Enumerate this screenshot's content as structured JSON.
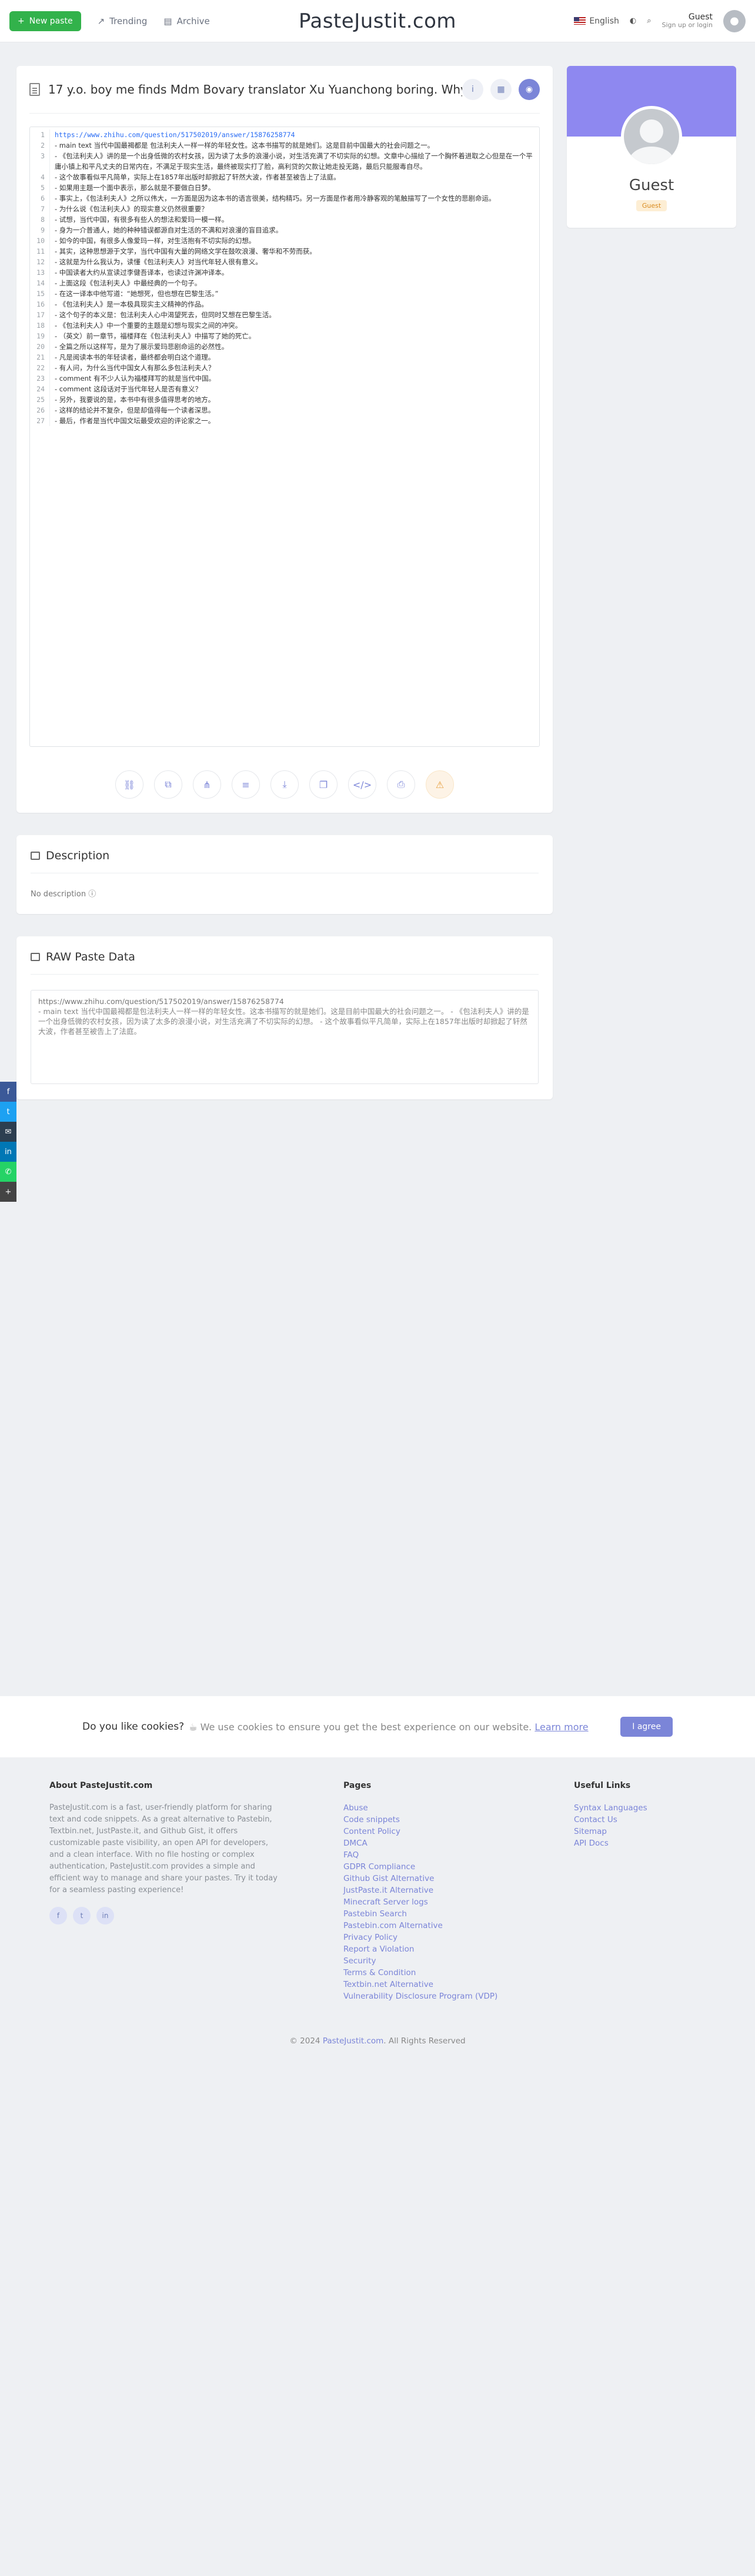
{
  "nav": {
    "new_paste": "New paste",
    "trending": "Trending",
    "archive": "Archive",
    "brand": "PasteJustit.com",
    "language": "English",
    "user_name": "Guest",
    "user_sub": "Sign up or login"
  },
  "paste": {
    "title": "17 y.o. boy me finds Mdm Bovary translator Xu Yuanchong boring. Why",
    "lines": [
      {
        "n": "1",
        "t": "https://www.zhihu.com/question/517502019/answer/15876258774",
        "url": true
      },
      {
        "n": "2",
        "t": "- main text 当代中国最褐都是 包法利夫人一样一样的年轻女性。这本书描写的就是她们。这是目前中国最大的社会问题之一。"
      },
      {
        "n": "3",
        "t": "- 《包法利夫人》讲的是一个出身低微的农村女孩，因为读了太多的浪漫小说，对生活充满了不切实际的幻想。文章中心描绘了一个胸怀着进取之心但是在一个平庸小镇上和平凡丈夫的日常内在，不满足于现实生活，最终被现实打了脸，高利贷的欠款让她走投无路，最后只能服毒自尽。"
      },
      {
        "n": "4",
        "t": "- 这个故事看似平凡简单，实际上在1857年出版时却掀起了轩然大波，作者甚至被告上了法庭。"
      },
      {
        "n": "5",
        "t": "- 如果用主题一个面中表示，那么就是不要做白日梦。"
      },
      {
        "n": "6",
        "t": "- 事实上，《包法利夫人》之所以伟大，一方面是因为这本书的语言很美，结构精巧。另一方面是作者用冷静客观的笔触描写了一个女性的悲剧命运。"
      },
      {
        "n": "7",
        "t": "- 为什么说《包法利夫人》的现实意义仍然很重要？"
      },
      {
        "n": "8",
        "t": "- 试想，当代中国，有很多有些人的想法和爱玛一模一样。"
      },
      {
        "n": "9",
        "t": "- 身为一介普通人，她的种种错误都源自对生活的不满和对浪漫的盲目追求。"
      },
      {
        "n": "10",
        "t": "- 如今的中国，有很多人像爱玛一样，对生活抱有不切实际的幻想。"
      },
      {
        "n": "11",
        "t": "- 其实，这种思想源于文学，当代中国有大量的网络文学在鼓吹浪漫、奢华和不劳而获。"
      },
      {
        "n": "12",
        "t": "- 这就是为什么我认为，读懂《包法利夫人》对当代年轻人很有意义。"
      },
      {
        "n": "13",
        "t": "- 中国读者大约从宣读过李健吾译本，也读过许渊冲译本。"
      },
      {
        "n": "14",
        "t": "- 上面这段《包法利夫人》中最经典的一个句子。"
      },
      {
        "n": "15",
        "t": "- 在这一译本中他写道：“她想死，但也想在巴黎生活。”"
      },
      {
        "n": "16",
        "t": "- 《包法利夫人》是一本极具现实主义精神的作品。"
      },
      {
        "n": "17",
        "t": "- 这个句子的本义是：包法利夫人心中渴望死去，但同时又想在巴黎生活。"
      },
      {
        "n": "18",
        "t": "- 《包法利夫人》中一个重要的主题是幻想与现实之间的冲突。"
      },
      {
        "n": "19",
        "t": "- （英文）前一章节，福楼拜在《包法利夫人》中描写了她的死亡。"
      },
      {
        "n": "20",
        "t": "- 全篇之所以这样写，是为了展示爱玛悲剧命运的必然性。"
      },
      {
        "n": "21",
        "t": "- 凡是阅读本书的年轻读者，最终都会明白这个道理。"
      },
      {
        "n": "22",
        "t": "- 有人问，为什么当代中国女人有那么多包法利夫人？"
      },
      {
        "n": "23",
        "t": "- comment 有不少人认为福楼拜写的就是当代中国。"
      },
      {
        "n": "24",
        "t": "- comment 这段话对于当代年轻人是否有意义？"
      },
      {
        "n": "25",
        "t": "- 另外，我要说的是，本书中有很多值得思考的地方。"
      },
      {
        "n": "26",
        "t": "- 这样的结论并不复杂，但是却值得每一个读者深思。"
      },
      {
        "n": "27",
        "t": "- 最后，作者是当代中国文坛最受欢迎的评论家之一。"
      }
    ]
  },
  "description": {
    "title": "Description",
    "empty": "No description"
  },
  "raw": {
    "title": "RAW Paste Data",
    "url": "https://www.zhihu.com/question/517502019/answer/15876258774",
    "text": "- main text 当代中国最褐都是包法利夫人一样一样的年轻女性。这本书描写的就是她们。这是目前中国最大的社会问题之一。 - 《包法利夫人》讲的是一个出身低微的农村女孩，因为读了太多的浪漫小说，对生活充满了不切实际的幻想。 - 这个故事看似平凡简单，实际上在1857年出版时却掀起了轩然大波，作者甚至被告上了法庭。"
  },
  "profile": {
    "name": "Guest",
    "badge": "Guest"
  },
  "cookie": {
    "question": "Do you like cookies?",
    "message": "We use cookies to ensure you get the best experience on our website.",
    "learn_more": "Learn more",
    "agree": "I agree"
  },
  "footer": {
    "about_title": "About PasteJustit.com",
    "about_text": "PasteJustit.com is a fast, user-friendly platform for sharing text and code snippets. As a great alternative to Pastebin, Textbin.net, JustPaste.it, and Github Gist, it offers customizable paste visibility, an open API for developers, and a clean interface. With no file hosting or complex authentication, PasteJustit.com provides a simple and efficient way to manage and share your pastes. Try it today for a seamless pasting experience!",
    "pages_title": "Pages",
    "pages": [
      "Abuse",
      "Code snippets",
      "Content Policy",
      "DMCA",
      "FAQ",
      "GDPR Compliance",
      "Github Gist Alternative",
      "JustPaste.it Alternative",
      "Minecraft Server logs",
      "Pastebin Search",
      "Pastebin.com Alternative",
      "Privacy Policy",
      "Report a Violation",
      "Security",
      "Terms & Condition",
      "Textbin.net Alternative",
      "Vulnerability Disclosure Program (VDP)"
    ],
    "useful_title": "Useful Links",
    "useful": [
      "Syntax Languages",
      "Contact Us",
      "Sitemap",
      "API Docs"
    ],
    "copyright_pre": "© 2024",
    "copyright_link": "PasteJustit.com",
    "copyright_post": ". All Rights Reserved"
  },
  "colors": {
    "accent": "#7b85d8",
    "new_paste": "#32b24b",
    "banner": "#8e88f0"
  }
}
